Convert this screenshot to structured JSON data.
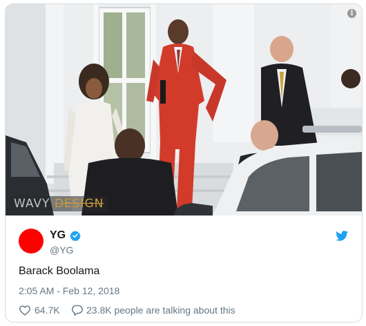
{
  "photo": {
    "watermark_part1": "WAVY",
    "watermark_part2": "DESIGN"
  },
  "tweet": {
    "name": "YG",
    "verified": true,
    "handle": "@YG",
    "text": "Barack Boolama",
    "timestamp": "2:05 AM - Feb 12, 2018",
    "likes": "64.7K",
    "talking": "23.8K people are talking about this"
  },
  "colors": {
    "avatar": "#ff0000",
    "verified_badge": "#1da1f2",
    "twitter_bird": "#1da1f2",
    "meta_text": "#657786"
  },
  "icons": [
    "info-icon",
    "verified-badge-icon",
    "twitter-bird-icon",
    "heart-icon",
    "comment-bubble-icon"
  ]
}
